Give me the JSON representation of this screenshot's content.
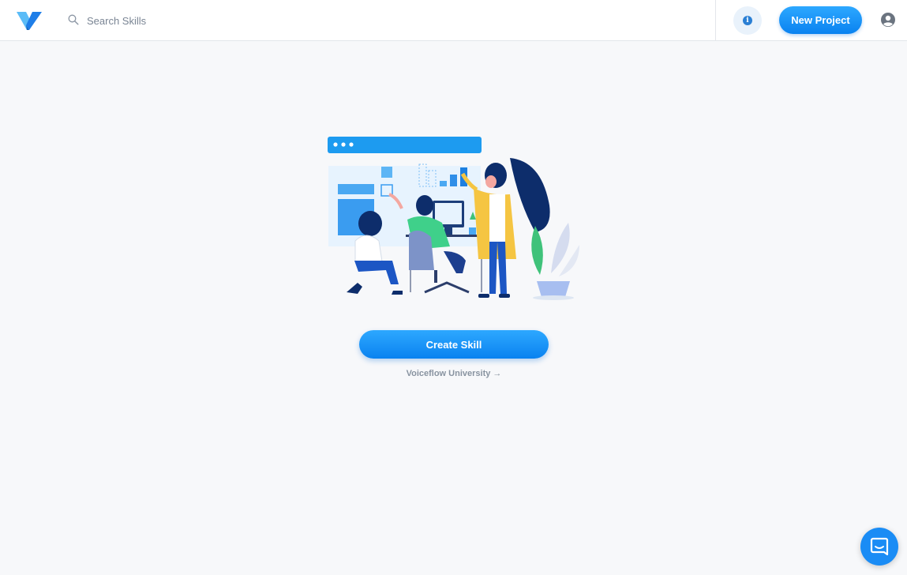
{
  "header": {
    "logo": "voiceflow-logo",
    "search": {
      "placeholder": "Search Skills",
      "value": "",
      "icon": "search-icon"
    },
    "info_icon": "info-icon",
    "new_project_label": "New Project",
    "user_icon": "user-avatar-icon"
  },
  "main": {
    "illustration": "team-collaboration-illustration",
    "create_label": "Create Skill",
    "university_label": "Voiceflow University →"
  },
  "chat": {
    "icon": "chat-messenger-icon"
  },
  "colors": {
    "accent": "#1a8cf5",
    "background": "#f7f8fa",
    "header_bg": "#ffffff",
    "muted_text": "#8893a0"
  }
}
